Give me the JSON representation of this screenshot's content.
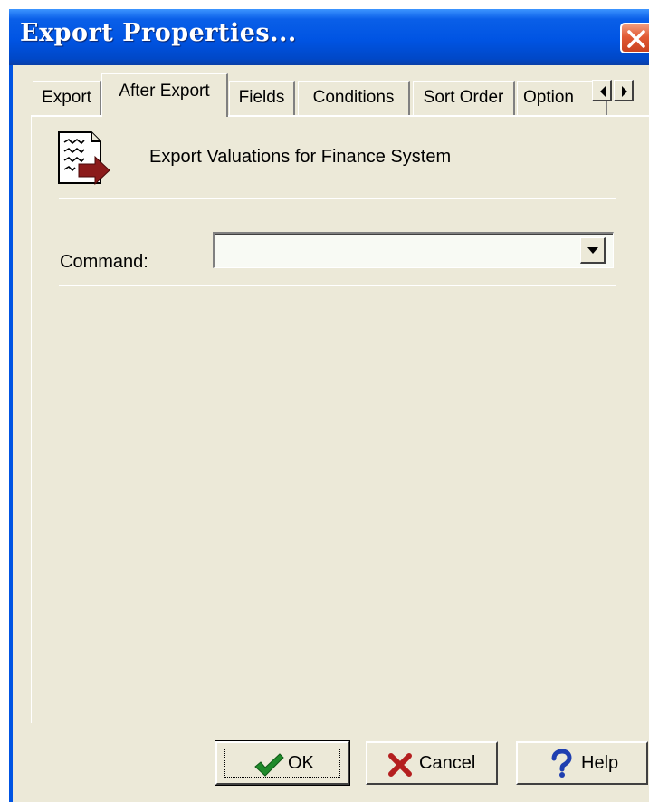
{
  "window": {
    "title": "Export Properties..."
  },
  "icons": {
    "close": "close-x-icon",
    "document": "export-document-icon",
    "ok": "checkmark-icon",
    "cancel": "red-x-icon",
    "help": "question-mark-icon"
  },
  "tabs": [
    {
      "label": "Export",
      "active": false
    },
    {
      "label": "After Export",
      "active": true
    },
    {
      "label": "Fields",
      "active": false
    },
    {
      "label": "Conditions",
      "active": false
    },
    {
      "label": "Sort Order",
      "active": false
    },
    {
      "label": "Option",
      "active": false
    }
  ],
  "after_export": {
    "description": "Export Valuations for Finance System",
    "command_label": "Command:",
    "command_value": ""
  },
  "buttons": {
    "ok": "OK",
    "cancel": "Cancel",
    "help": "Help"
  },
  "colors": {
    "titlebar": "#0054E3",
    "dialog_bg": "#ECE9D8",
    "close_button": "#E25A33",
    "ok_check": "#1F8A2A",
    "cancel_x": "#B41F1F",
    "help_mark": "#1F3FB0",
    "arrow": "#8B1A1A"
  }
}
